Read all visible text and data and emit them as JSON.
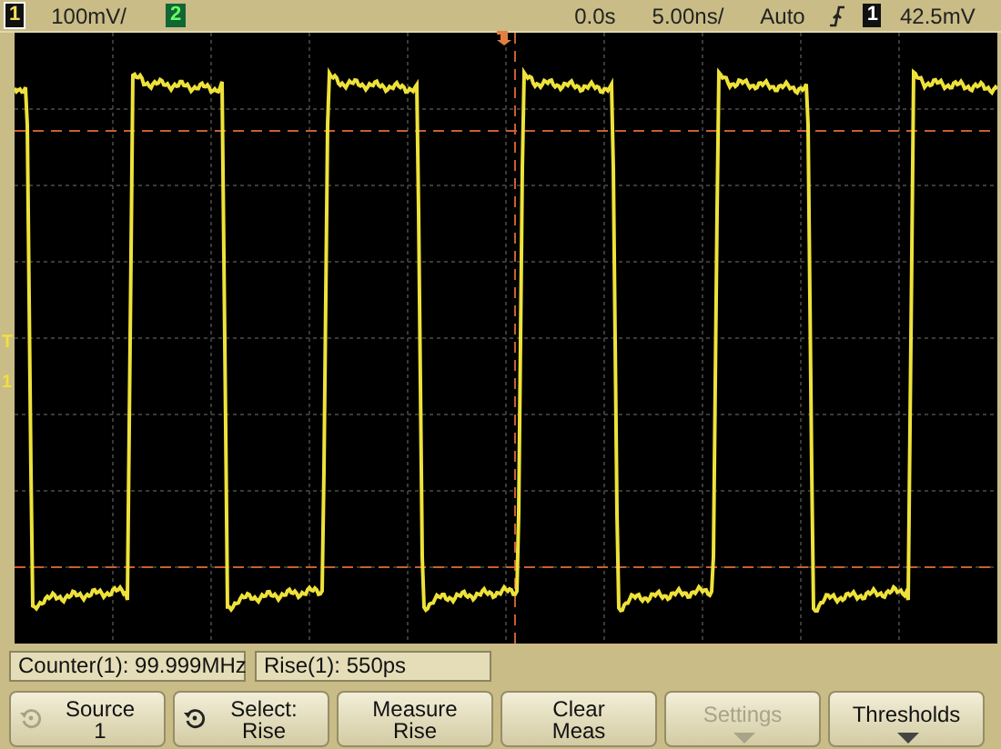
{
  "header": {
    "channel_1": {
      "badge": "1",
      "scale": "100mV/"
    },
    "channel_2": {
      "badge": "2"
    },
    "delay": "0.0s",
    "timebase": "5.00ns/",
    "trigger_mode": "Auto",
    "trigger_source": "1",
    "trigger_level": "42.5mV"
  },
  "screen": {
    "markers": [
      {
        "label": "T"
      },
      {
        "label": "1"
      }
    ]
  },
  "measurements": [
    "Counter(1): 99.999MHz",
    "Rise(1): 550ps"
  ],
  "softkeys": [
    {
      "lines": [
        "Source",
        "1"
      ],
      "kind": "knob",
      "knob_enabled": false,
      "menu": false,
      "disabled": false
    },
    {
      "lines": [
        "Select:",
        "Rise"
      ],
      "kind": "knob",
      "knob_enabled": true,
      "menu": false,
      "disabled": false
    },
    {
      "lines": [
        "Measure",
        "Rise"
      ],
      "menu": false,
      "disabled": false
    },
    {
      "lines": [
        "Clear",
        "Meas"
      ],
      "menu": false,
      "disabled": false
    },
    {
      "lines": [
        "Settings"
      ],
      "menu": true,
      "disabled": true
    },
    {
      "lines": [
        "Thresholds"
      ],
      "menu": true,
      "disabled": false
    }
  ]
}
